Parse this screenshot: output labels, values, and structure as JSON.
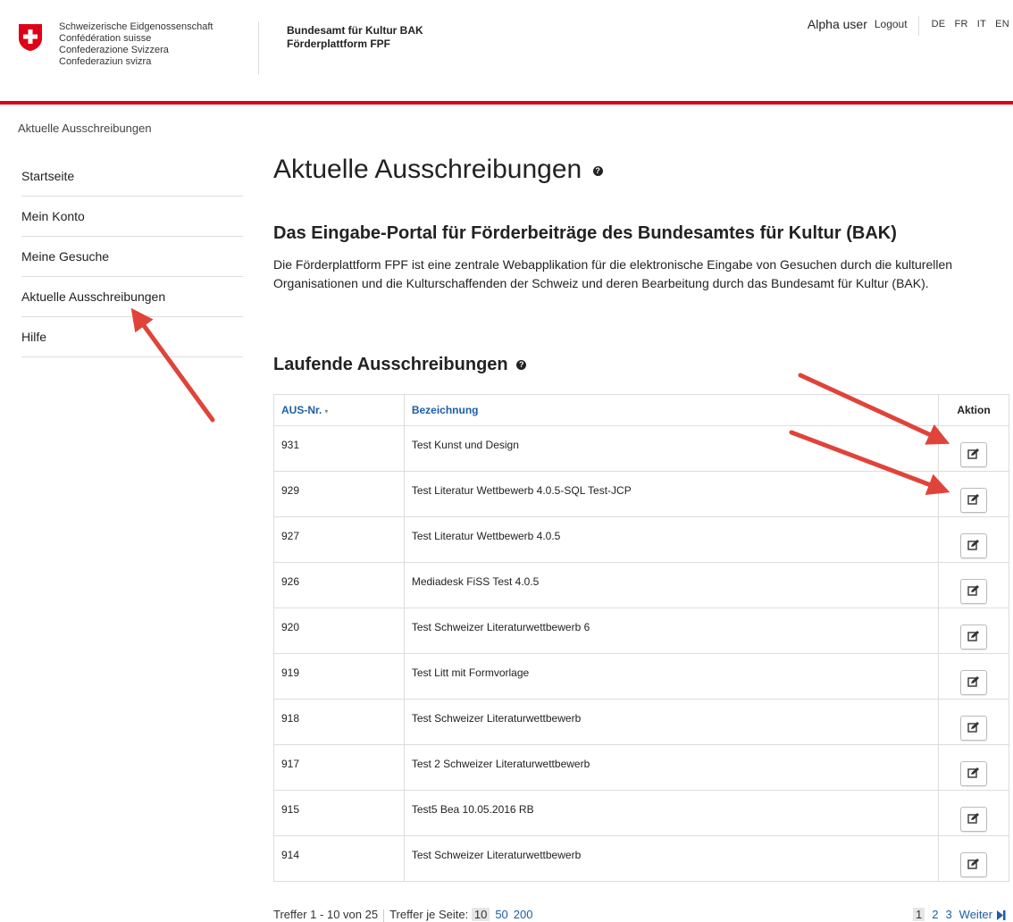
{
  "header": {
    "confederation": [
      "Schweizerische Eidgenossenschaft",
      "Confédération suisse",
      "Confederazione Svizzera",
      "Confederaziun svizra"
    ],
    "office_line1": "Bundesamt für Kultur BAK",
    "office_line2": "Förderplattform FPF",
    "username": "Alpha user",
    "logout": "Logout",
    "languages": [
      "DE",
      "FR",
      "IT",
      "EN"
    ],
    "accent": "#dc0018"
  },
  "breadcrumb": "Aktuelle Ausschreibungen",
  "sidebar": {
    "items": [
      {
        "label": "Startseite"
      },
      {
        "label": "Mein Konto"
      },
      {
        "label": "Meine Gesuche"
      },
      {
        "label": "Aktuelle Ausschreibungen"
      },
      {
        "label": "Hilfe"
      }
    ]
  },
  "main": {
    "title": "Aktuelle Ausschreibungen",
    "subtitle": "Das Eingabe-Portal für Förderbeiträge des Bundesamtes für Kultur (BAK)",
    "lead": "Die Förderplattform FPF ist eine zentrale Webapplikation für die elektronische Eingabe von Gesuchen durch die kulturellen Organisationen und die Kulturschaffenden der Schweiz und deren Bearbeitung durch das Bundesamt für Kultur (BAK).",
    "section_title": "Laufende Ausschreibungen"
  },
  "table": {
    "headers": {
      "nr": "AUS-Nr.",
      "name": "Bezeichnung",
      "action": "Aktion"
    },
    "rows": [
      {
        "nr": "931",
        "name": "Test Kunst und Design"
      },
      {
        "nr": "929",
        "name": "Test Literatur Wettbewerb 4.0.5-SQL Test-JCP"
      },
      {
        "nr": "927",
        "name": "Test Literatur Wettbewerb 4.0.5"
      },
      {
        "nr": "926",
        "name": "Mediadesk FiSS Test 4.0.5"
      },
      {
        "nr": "920",
        "name": "Test Schweizer Literaturwettbewerb 6"
      },
      {
        "nr": "919",
        "name": "Test Litt mit Formvorlage"
      },
      {
        "nr": "918",
        "name": "Test Schweizer Literaturwettbewerb"
      },
      {
        "nr": "917",
        "name": "Test 2 Schweizer Literaturwettbewerb"
      },
      {
        "nr": "915",
        "name": "Test5 Bea 10.05.2016 RB"
      },
      {
        "nr": "914",
        "name": "Test Schweizer Literaturwettbewerb"
      }
    ]
  },
  "footer": {
    "hits": "Treffer 1 - 10 von 25",
    "per_page_label": "Treffer je Seite:",
    "per_page_options": [
      "10",
      "50",
      "200"
    ],
    "pages": [
      "1",
      "2",
      "3"
    ],
    "next": "Weiter"
  }
}
